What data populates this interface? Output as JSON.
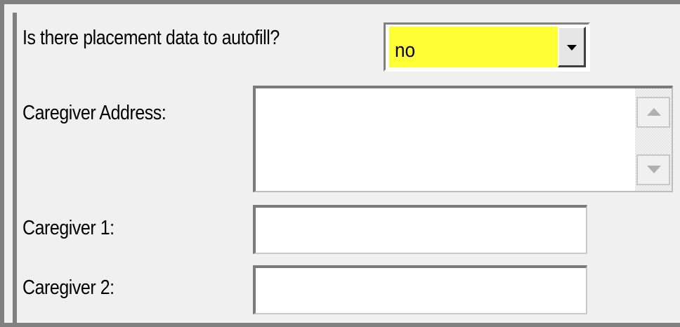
{
  "form": {
    "autofill_question": "Is there placement data to autofill?",
    "autofill_value": "no",
    "autofill_highlight_color": "#ffff33",
    "caregiver_address_label": "Caregiver Address:",
    "caregiver_address_value": "",
    "caregiver1_label": "Caregiver 1:",
    "caregiver1_value": "",
    "caregiver2_label": "Caregiver 2:",
    "caregiver2_value": ""
  },
  "icons": {
    "dropdown": "chevron-down-icon",
    "scroll_up": "scroll-up-arrow-icon",
    "scroll_down": "scroll-down-arrow-icon"
  }
}
